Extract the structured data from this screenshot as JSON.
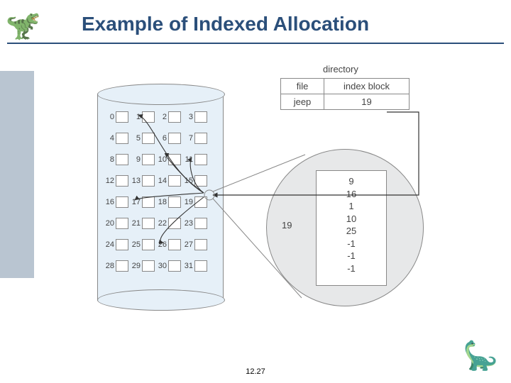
{
  "title": "Example of Indexed Allocation",
  "page_number": "12.27",
  "disk_blocks": [
    [
      0,
      1,
      2,
      3
    ],
    [
      4,
      5,
      6,
      7
    ],
    [
      8,
      9,
      10,
      11
    ],
    [
      12,
      13,
      14,
      15
    ],
    [
      16,
      17,
      18,
      19
    ],
    [
      20,
      21,
      22,
      23
    ],
    [
      24,
      25,
      26,
      27
    ],
    [
      28,
      29,
      30,
      31
    ]
  ],
  "directory": {
    "label": "directory",
    "headers": {
      "c1": "file",
      "c2": "index block"
    },
    "row": {
      "c1": "jeep",
      "c2": "19"
    }
  },
  "index_block": {
    "label": "19",
    "entries": [
      "9",
      "16",
      "1",
      "10",
      "25",
      "-1",
      "-1",
      "-1"
    ]
  },
  "icons": {
    "dino_left": "🦖",
    "dino_right": "🦕"
  }
}
